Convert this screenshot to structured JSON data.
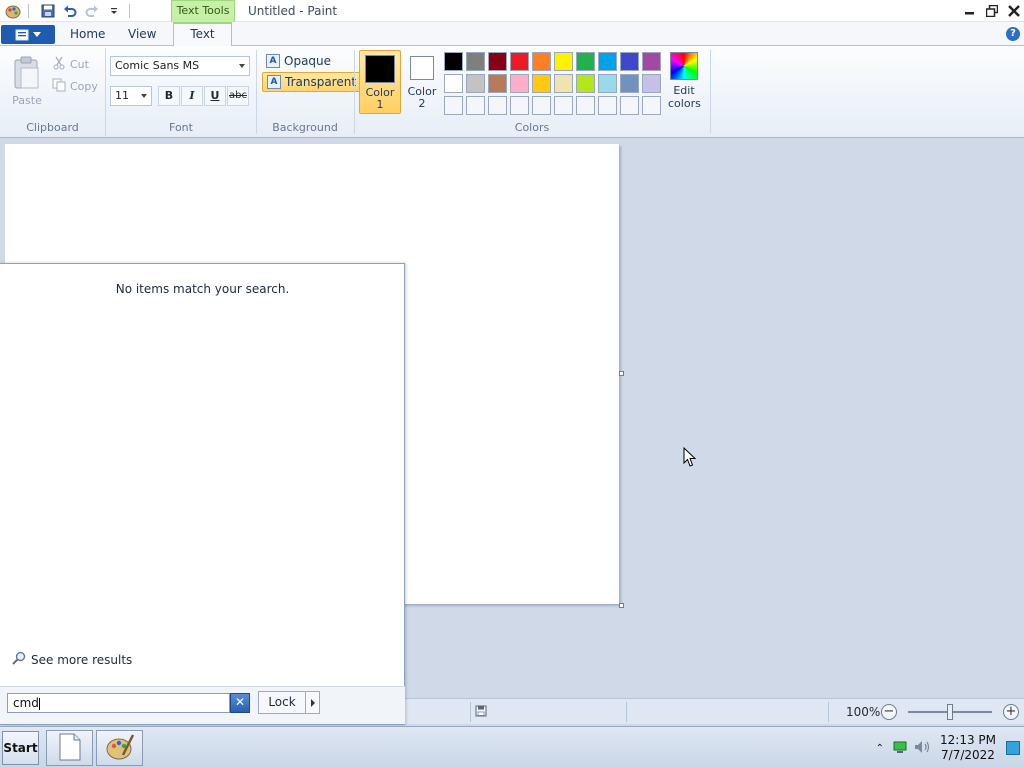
{
  "window": {
    "title": "Untitled - Paint",
    "context_tab_title": "Text Tools"
  },
  "tabs": [
    {
      "label": "Home"
    },
    {
      "label": "View"
    },
    {
      "label": "Text",
      "active": true
    }
  ],
  "ribbon": {
    "clipboard": {
      "label": "Clipboard",
      "paste": "Paste",
      "cut": "Cut",
      "copy": "Copy"
    },
    "font": {
      "label": "Font",
      "family": "Comic Sans MS",
      "size": "11",
      "bold": "B",
      "italic": "I",
      "underline": "U",
      "strikethrough": "abc"
    },
    "background": {
      "label": "Background",
      "opaque": "Opaque",
      "transparent": "Transparent",
      "selected": "transparent"
    },
    "colors": {
      "label": "Colors",
      "color1_label_line1": "Color",
      "color1_label_line2": "1",
      "color1": "#000000",
      "color2_label_line1": "Color",
      "color2_label_line2": "2",
      "color2": "#ffffff",
      "edit_label_line1": "Edit",
      "edit_label_line2": "colors",
      "palette": [
        "#000000",
        "#7f7f7f",
        "#880015",
        "#ed1c24",
        "#ff7f27",
        "#fff200",
        "#22b14c",
        "#00a2e8",
        "#3f48cc",
        "#a349a4",
        "#ffffff",
        "#c3c3c3",
        "#b97a57",
        "#ffaec9",
        "#ffc90e",
        "#efe4b0",
        "#b5e61d",
        "#99d9ea",
        "#7092be",
        "#c8bfe7",
        "#f4f6f9",
        "#f4f6f9",
        "#f4f6f9",
        "#f4f6f9",
        "#f4f6f9",
        "#f4f6f9",
        "#f4f6f9",
        "#f4f6f9",
        "#f4f6f9",
        "#f4f6f9"
      ]
    }
  },
  "status": {
    "zoom": "100%"
  },
  "start_menu": {
    "no_items_text": "No items match your search.",
    "see_more": "See more results",
    "search_value": "cmd",
    "lock_label": "Lock"
  },
  "taskbar": {
    "start_label": "Start",
    "time": "12:13 PM",
    "date": "7/7/2022"
  }
}
